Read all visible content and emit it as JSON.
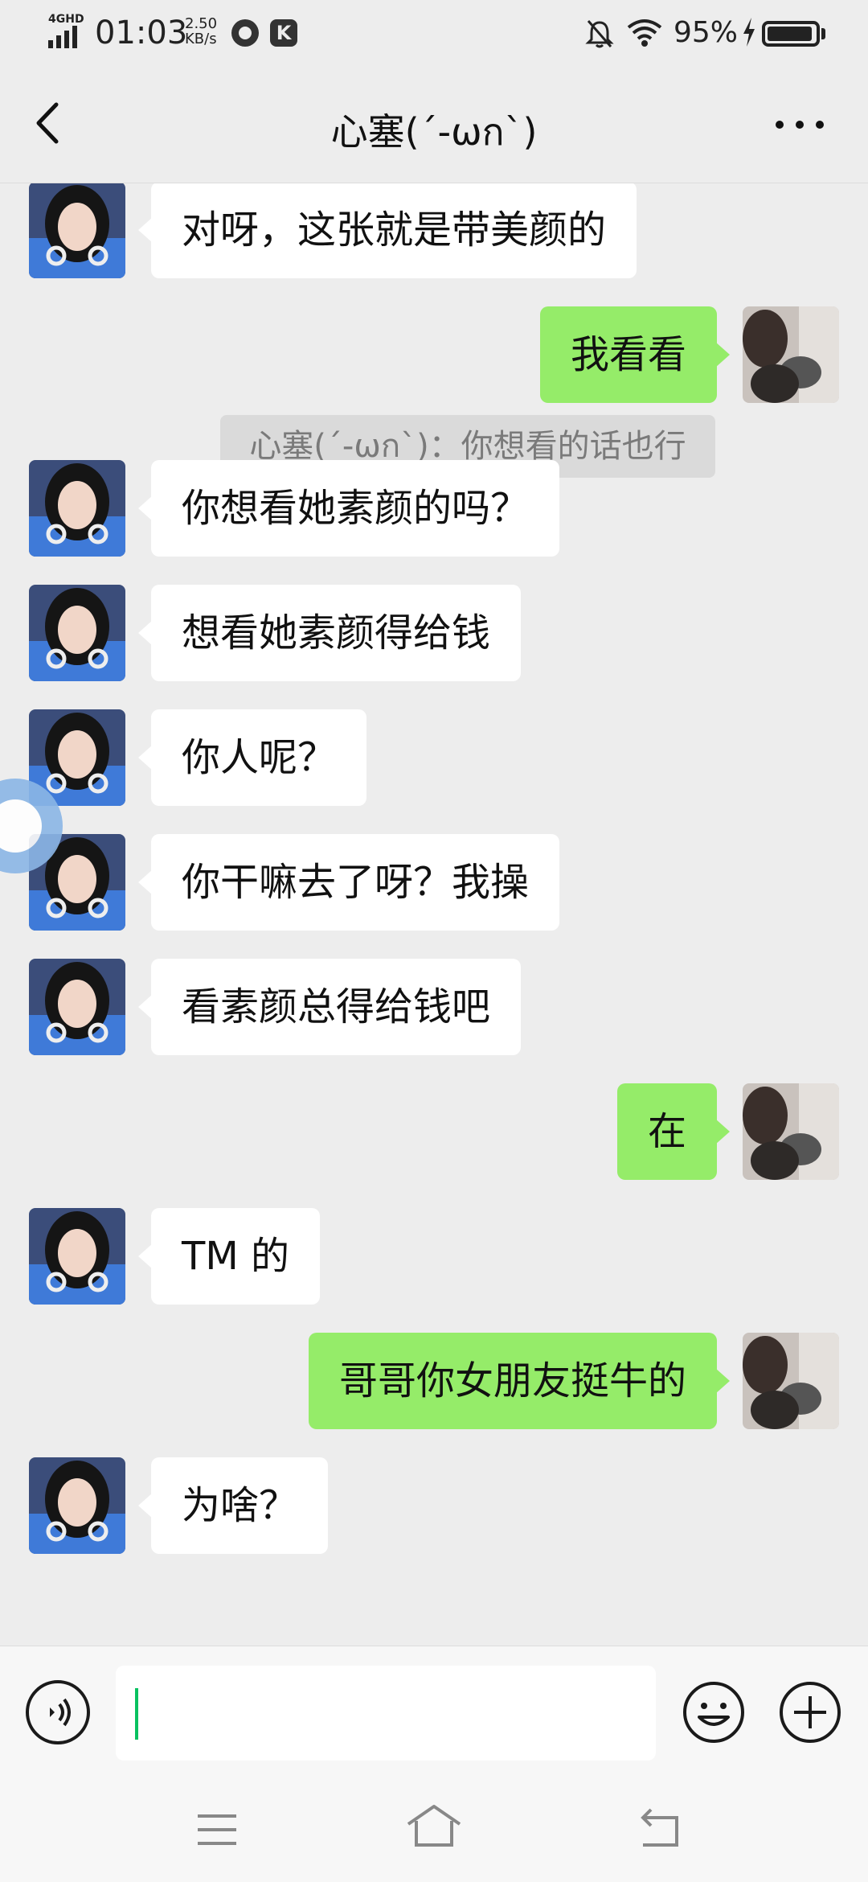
{
  "status_bar": {
    "network": "4GHD",
    "time": "01:03",
    "speed_value": "2.50",
    "speed_unit": "KB/s",
    "battery": "95%",
    "battery_level": 0.95,
    "app_icon_2": "K"
  },
  "header": {
    "title": "心塞(´-ωก`)"
  },
  "messages": [
    {
      "side": "in",
      "text": "对呀，这张就是带美颜的"
    },
    {
      "side": "out",
      "text": "我看看"
    },
    {
      "side": "system",
      "text": "心塞(´-ωก`)：你想看的话也行"
    },
    {
      "side": "in",
      "text": "你想看她素颜的吗？"
    },
    {
      "side": "in",
      "text": "想看她素颜得给钱"
    },
    {
      "side": "in",
      "text": "你人呢？"
    },
    {
      "side": "in",
      "text": "你干嘛去了呀？我操"
    },
    {
      "side": "in",
      "text": "看素颜总得给钱吧"
    },
    {
      "side": "out",
      "text": "在"
    },
    {
      "side": "in",
      "text": "TM 的"
    },
    {
      "side": "out",
      "text": "哥哥你女朋友挺牛的"
    },
    {
      "side": "in",
      "text": "为啥？"
    }
  ],
  "input": {
    "value": "",
    "placeholder": ""
  },
  "colors": {
    "background": "#ededed",
    "incoming_bubble": "#ffffff",
    "outgoing_bubble": "#95ec69",
    "caret": "#07c160",
    "system_note_text": "#7a7a7a"
  },
  "icons": {
    "back": "chevron-left-icon",
    "more": "more-dots-icon",
    "voice": "voice-icon",
    "emoji": "emoji-icon",
    "plus": "plus-icon",
    "menu": "menu-icon",
    "home": "home-icon",
    "nav_back": "return-icon"
  }
}
